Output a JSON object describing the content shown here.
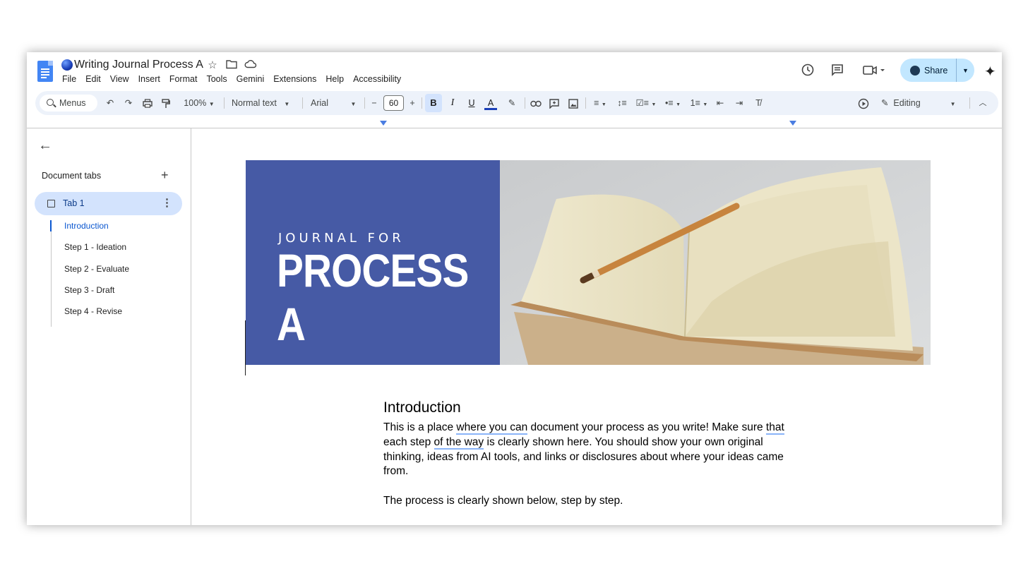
{
  "doc": {
    "title": "Writing Journal Process A",
    "menu": [
      "File",
      "Edit",
      "View",
      "Insert",
      "Format",
      "Tools",
      "Gemini",
      "Extensions",
      "Help",
      "Accessibility"
    ],
    "share_label": "Share"
  },
  "toolbar": {
    "search_label": "Menus",
    "zoom": "100%",
    "style": "Normal text",
    "font": "Arial",
    "font_size": "60",
    "bold_label": "B",
    "italic_label": "I",
    "underline_label": "U",
    "text_color_label": "A",
    "mode": "Editing"
  },
  "sidebar": {
    "heading": "Document tabs",
    "tab_label": "Tab 1",
    "outline": [
      "Introduction",
      "Step 1 - Ideation",
      "Step 2 - Evaluate",
      "Step 3 - Draft",
      "Step 4 - Revise"
    ]
  },
  "banner": {
    "line1": "JOURNAL FOR",
    "line2": "PROCESS A",
    "color": "#465aa5"
  },
  "body": {
    "heading": "Introduction",
    "p1_a": "This is a place ",
    "p1_u1": "where you can",
    "p1_b": " document your process as you write! Make sure ",
    "p1_u2": "that",
    "p1_c": " each step ",
    "p1_u3": "of the way",
    "p1_d": " is clearly shown here. You should show your own original thinking, ideas from AI tools, and links or disclosures about where your ideas came from.",
    "p2": "The process is clearly shown below, step by step."
  },
  "icons": {
    "undo": "undo-icon",
    "redo": "redo-icon",
    "print": "print-icon",
    "paint": "paint-format-icon",
    "history": "history-icon",
    "comments": "comment-icon",
    "meet": "video-call-icon",
    "gemini": "gemini-star-icon"
  }
}
